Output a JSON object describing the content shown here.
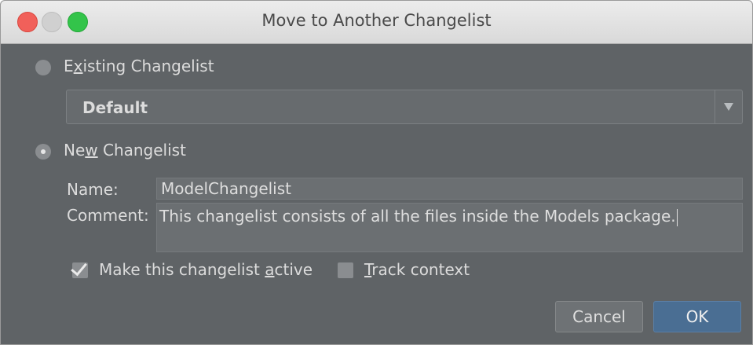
{
  "window": {
    "title": "Move to Another Changelist"
  },
  "existing": {
    "label_pre": "E",
    "label_mnemonic": "x",
    "label_post": "isting Changelist",
    "selected": false,
    "dropdown_value": "Default"
  },
  "new_changelist": {
    "label_pre": "Ne",
    "label_mnemonic": "w",
    "label_post": " Changelist",
    "selected": true,
    "name_label": "Name:",
    "name_value": "ModelChangelist",
    "comment_label": "Comment:",
    "comment_value": "This changelist consists of all the files inside the Models package."
  },
  "options": {
    "make_active_pre": "Make this changelist ",
    "make_active_mnemonic": "a",
    "make_active_post": "ctive",
    "make_active_checked": true,
    "track_context_mnemonic": "T",
    "track_context_post": "rack context",
    "track_context_checked": false
  },
  "buttons": {
    "cancel": "Cancel",
    "ok": "OK"
  },
  "icons": {
    "close": "close-icon",
    "minimize": "minimize-icon",
    "maximize": "maximize-icon",
    "dropdown": "chevron-down-icon",
    "check": "checkmark-icon"
  },
  "colors": {
    "dialog_bg": "#5f6366",
    "ok_button": "#4a6e93",
    "close_button": "#f1605a",
    "maximize_button": "#33c44a"
  }
}
